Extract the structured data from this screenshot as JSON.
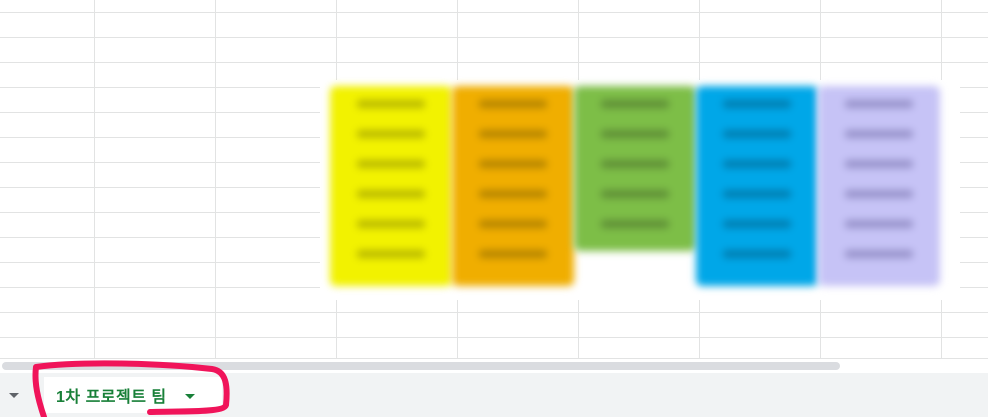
{
  "sheet_tabs": [
    {
      "label": "1차 프로젝트 팀",
      "active": true
    }
  ],
  "blurred_image": {
    "bands": [
      {
        "color": "#f2f200",
        "text_color": "#b8b800",
        "lines": 6
      },
      {
        "color": "#f0ae00",
        "text_color": "#b48400",
        "lines": 6
      },
      {
        "color": "#7dbe47",
        "text_color": "#5e8e36",
        "lines": 5,
        "short": true
      },
      {
        "color": "#00a7e8",
        "text_color": "#007db0",
        "lines": 6
      },
      {
        "color": "#c6c3f6",
        "text_color": "#9691c9",
        "lines": 6
      }
    ]
  },
  "colors": {
    "grid_line": "#e2e3e3",
    "sheet_bar": "#f1f3f4",
    "active_tab_text": "#188038",
    "annotation": "#f0145a"
  },
  "icons": {
    "all_sheets": "caret-down-icon",
    "tab_menu": "caret-down-icon"
  }
}
